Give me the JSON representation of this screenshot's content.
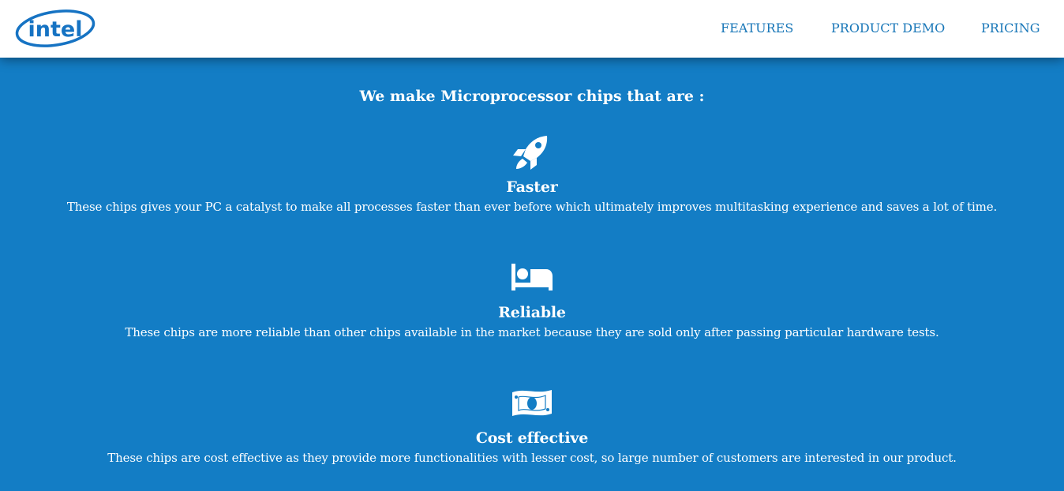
{
  "header": {
    "logo_text": "intel",
    "nav": [
      {
        "label": "FEATURES"
      },
      {
        "label": "PRODUCT DEMO"
      },
      {
        "label": "PRICING"
      }
    ]
  },
  "main": {
    "headline": "We make Microprocessor chips that are :",
    "features": [
      {
        "icon": "rocket-icon",
        "title": "Faster",
        "description": "These chips gives your PC a catalyst to make all processes faster than ever before which ultimately improves multitasking experience and saves a lot of time."
      },
      {
        "icon": "bed-icon",
        "title": "Reliable",
        "description": "These chips are more reliable than other chips available in the market because they are sold only after passing particular hardware tests."
      },
      {
        "icon": "money-bill-icon",
        "title": "Cost effective",
        "description": "These chips are cost effective as they provide more functionalities with lesser cost, so large number of customers are interested in our product."
      }
    ]
  },
  "colors": {
    "background": "#137dc5",
    "header_bg": "#ffffff",
    "nav_text": "#1977b8",
    "logo": "#1673c3",
    "text": "#ffffff"
  }
}
